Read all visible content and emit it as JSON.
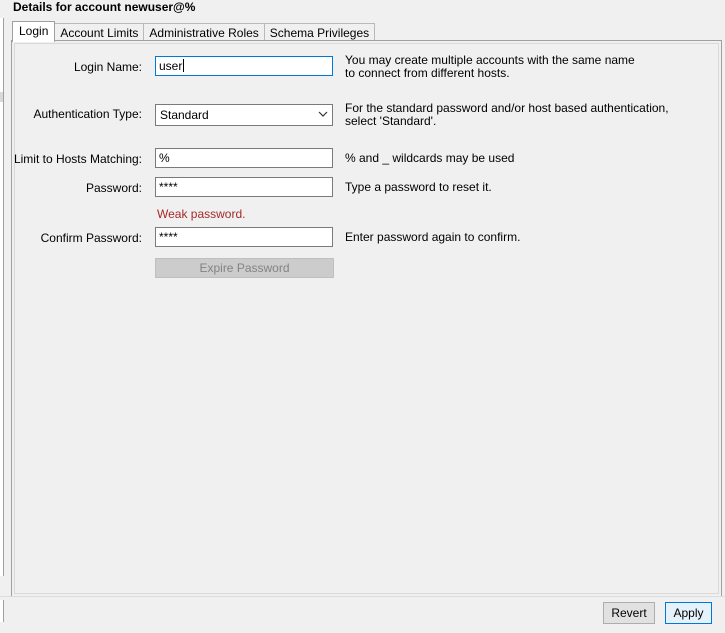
{
  "window": {
    "title": "Details for account newuser@%"
  },
  "tabs": [
    {
      "label": "Login",
      "active": true
    },
    {
      "label": "Account Limits",
      "active": false
    },
    {
      "label": "Administrative Roles",
      "active": false
    },
    {
      "label": "Schema Privileges",
      "active": false
    }
  ],
  "form": {
    "login_name": {
      "label": "Login Name:",
      "value": "user",
      "help_line1": "You may create multiple accounts with the same name",
      "help_line2": "to connect from different hosts."
    },
    "auth_type": {
      "label": "Authentication Type:",
      "value": "Standard",
      "help_line1": "For the standard password and/or host based authentication,",
      "help_line2": "select 'Standard'."
    },
    "hosts": {
      "label": "Limit to Hosts Matching:",
      "value": "%",
      "help": "% and _ wildcards may be used"
    },
    "password": {
      "label": "Password:",
      "value": "****",
      "help": "Type a password to reset it.",
      "strength": "Weak password."
    },
    "confirm_password": {
      "label": "Confirm Password:",
      "value": "****",
      "help": "Enter password again to confirm."
    },
    "expire_button": "Expire Password"
  },
  "footer": {
    "revert": "Revert",
    "apply": "Apply"
  },
  "colors": {
    "focus_border": "#0078d7",
    "warning": "#a52a2a",
    "disabled_bg": "#cccccc"
  }
}
